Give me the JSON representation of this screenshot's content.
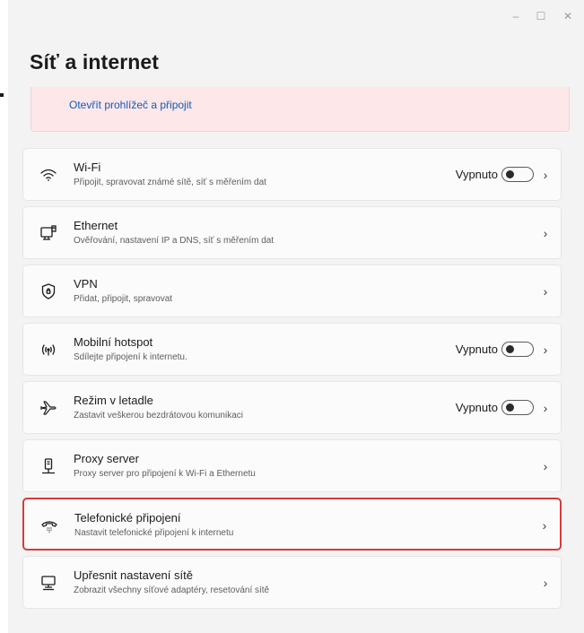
{
  "window": {
    "title": "Síť a internet",
    "controls": [
      "–",
      "☐",
      "✕"
    ]
  },
  "banner": {
    "link_label": "Otevřít prohlížeč a připojit"
  },
  "rows": [
    {
      "title": "Wi-Fi",
      "subtitle": "Připojit, spravovat známé sítě, síť s měřením dat",
      "state": "Vypnuto",
      "has_toggle": true,
      "icon": "wifi-icon"
    },
    {
      "title": "Ethernet",
      "subtitle": "Ověřování, nastavení IP a DNS, síť s měřením dat",
      "state": "",
      "has_toggle": false,
      "icon": "ethernet-icon"
    },
    {
      "title": "VPN",
      "subtitle": "Přidat, připojit, spravovat",
      "state": "",
      "has_toggle": false,
      "icon": "vpn-shield-icon"
    },
    {
      "title": "Mobilní hotspot",
      "subtitle": "Sdílejte připojení k internetu.",
      "state": "Vypnuto",
      "has_toggle": true,
      "icon": "hotspot-icon"
    },
    {
      "title": "Režim v letadle",
      "subtitle": "Zastavit veškerou bezdrátovou komunikaci",
      "state": "Vypnuto",
      "has_toggle": true,
      "icon": "airplane-icon"
    },
    {
      "title": "Proxy server",
      "subtitle": "Proxy server pro připojení k Wi-Fi a Ethernetu",
      "state": "",
      "has_toggle": false,
      "icon": "proxy-icon"
    },
    {
      "title": "Telefonické připojení",
      "subtitle": "Nastavit telefonické připojení k internetu",
      "state": "",
      "has_toggle": false,
      "icon": "dial-up-icon",
      "highlighted": true
    },
    {
      "title": "Upřesnit nastavení sítě",
      "subtitle": "Zobrazit všechny síťové adaptéry, resetování sítě",
      "state": "",
      "has_toggle": false,
      "icon": "network-adapter-icon"
    }
  ],
  "colors": {
    "accent_link": "#0f5cb8",
    "banner_bg": "#fde7e9",
    "highlight_border": "#d83b3b",
    "window_bg": "#f3f3f3"
  },
  "chevron": "›"
}
